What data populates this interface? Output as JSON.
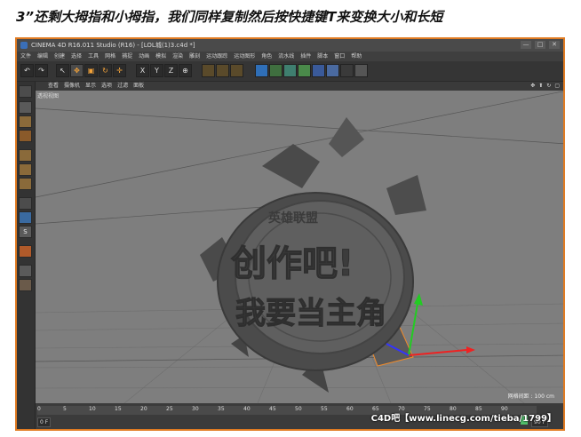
{
  "caption": "3”还剩大拇指和小拇指，我们同样复制然后按快捷键T来变换大小和长短",
  "window": {
    "title": "CINEMA 4D R16.011 Studio (R16) - [LOL城(1)3.c4d *]",
    "controls": [
      "—",
      "□",
      "✕"
    ]
  },
  "menu": [
    "文件",
    "编辑",
    "创建",
    "选择",
    "工具",
    "网格",
    "捕捉",
    "动画",
    "模拟",
    "渲染",
    "雕刻",
    "运动跟踪",
    "运动图形",
    "角色",
    "流水线",
    "插件",
    "脚本",
    "窗口",
    "帮助"
  ],
  "toolbar": {
    "undo": "↶",
    "redo": "↷",
    "tools": [
      "↖",
      "✥",
      "▣",
      "↻",
      "✛"
    ],
    "axes": [
      "X",
      "Y",
      "Z",
      "⊕"
    ]
  },
  "viewport": {
    "menu": [
      "查看",
      "摄像机",
      "显示",
      "选项",
      "过滤",
      "面板"
    ],
    "nav_icons": [
      "✥",
      "⬆",
      "↻",
      "▢"
    ],
    "view_label": "透视视图",
    "grid_label": "网格间距 : 100 cm",
    "logo_text_top": "英雄联盟",
    "logo_text_mid": "创作吧!",
    "logo_text_bottom": "我要当主角"
  },
  "timeline": {
    "ticks": [
      "0",
      "5",
      "10",
      "15",
      "20",
      "25",
      "30",
      "35",
      "40",
      "45",
      "50",
      "55",
      "60",
      "65",
      "70",
      "75",
      "80",
      "85",
      "90"
    ],
    "current_frame": "0 F",
    "end_frame": "90 F"
  },
  "watermark": "C4D吧【www.linecg.com/tieba/1799】"
}
